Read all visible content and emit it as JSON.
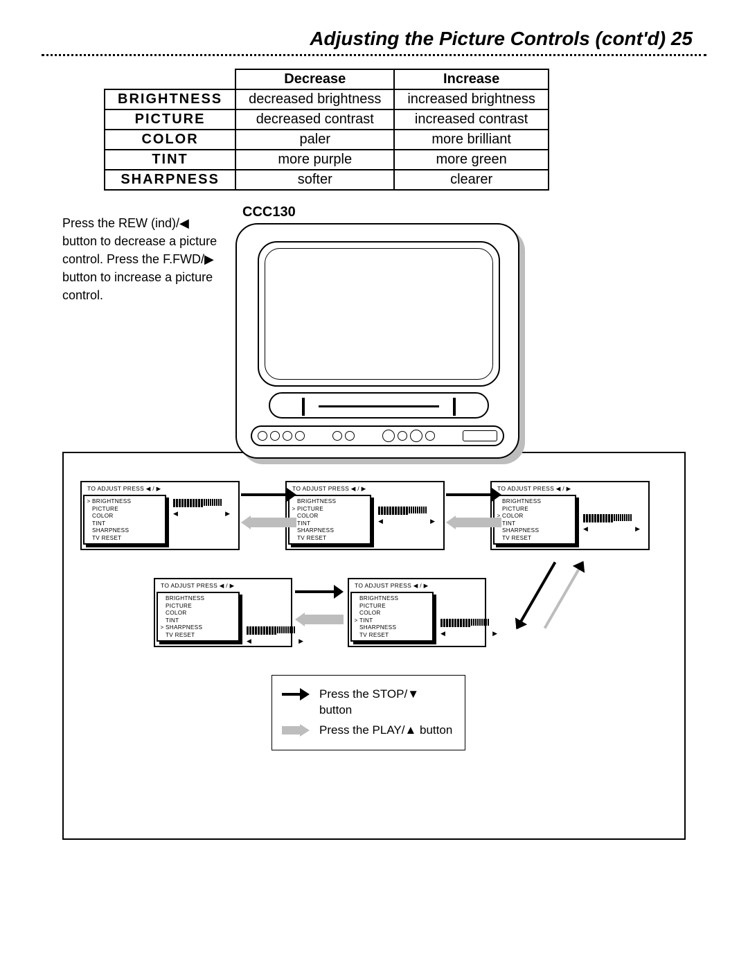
{
  "header": {
    "title": "Adjusting the Picture Controls (cont'd)",
    "page": "25"
  },
  "table": {
    "col_decrease": "Decrease",
    "col_increase": "Increase",
    "rows": [
      {
        "name": "BRIGHTNESS",
        "dec": "decreased brightness",
        "inc": "increased brightness"
      },
      {
        "name": "PICTURE",
        "dec": "decreased contrast",
        "inc": "increased contrast"
      },
      {
        "name": "COLOR",
        "dec": "paler",
        "inc": "more brilliant"
      },
      {
        "name": "TINT",
        "dec": "more purple",
        "inc": "more green"
      },
      {
        "name": "SHARPNESS",
        "dec": "softer",
        "inc": "clearer"
      }
    ]
  },
  "model": "CCC130",
  "instruction": "Press the REW (ind)/◀ button to decrease a picture control. Press the F.FWD/▶ button to increase a picture control.",
  "osd": {
    "header": "TO ADJUST PRESS ◀ / ▶",
    "items": [
      "BRIGHTNESS",
      "PICTURE",
      "COLOR",
      "TINT",
      "SHARPNESS",
      "TV RESET"
    ],
    "marker": ">",
    "slider_left": "◀",
    "slider_right": "▶",
    "screens": [
      {
        "selected": 0
      },
      {
        "selected": 1
      },
      {
        "selected": 2
      },
      {
        "selected": 4
      },
      {
        "selected": 3
      }
    ]
  },
  "legend": {
    "stop": "Press the STOP/▼ button",
    "play": "Press the PLAY/▲ button"
  }
}
